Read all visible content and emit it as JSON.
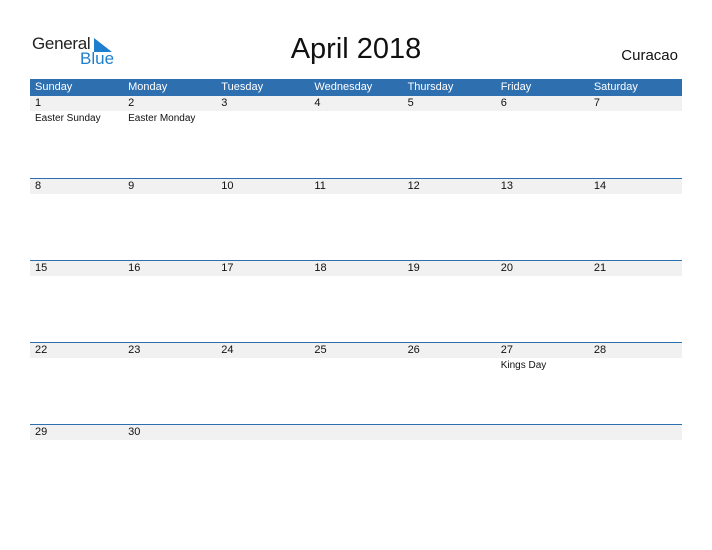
{
  "logo": {
    "general": "General",
    "blue": "Blue"
  },
  "title": "April 2018",
  "country": "Curacao",
  "colors": {
    "header_bg": "#2e6fb0",
    "day_bar_bg": "#f1f1f1",
    "logo_blue": "#1f7fcf"
  },
  "weekdays": [
    "Sunday",
    "Monday",
    "Tuesday",
    "Wednesday",
    "Thursday",
    "Friday",
    "Saturday"
  ],
  "weeks": [
    {
      "days": [
        "1",
        "2",
        "3",
        "4",
        "5",
        "6",
        "7"
      ],
      "events": [
        "Easter Sunday",
        "Easter Monday",
        "",
        "",
        "",
        "",
        ""
      ]
    },
    {
      "days": [
        "8",
        "9",
        "10",
        "11",
        "12",
        "13",
        "14"
      ],
      "events": [
        "",
        "",
        "",
        "",
        "",
        "",
        ""
      ]
    },
    {
      "days": [
        "15",
        "16",
        "17",
        "18",
        "19",
        "20",
        "21"
      ],
      "events": [
        "",
        "",
        "",
        "",
        "",
        "",
        ""
      ]
    },
    {
      "days": [
        "22",
        "23",
        "24",
        "25",
        "26",
        "27",
        "28"
      ],
      "events": [
        "",
        "",
        "",
        "",
        "",
        "Kings Day",
        ""
      ]
    },
    {
      "days": [
        "29",
        "30",
        "",
        "",
        "",
        "",
        ""
      ],
      "events": [
        "",
        "",
        "",
        "",
        "",
        "",
        ""
      ]
    }
  ]
}
